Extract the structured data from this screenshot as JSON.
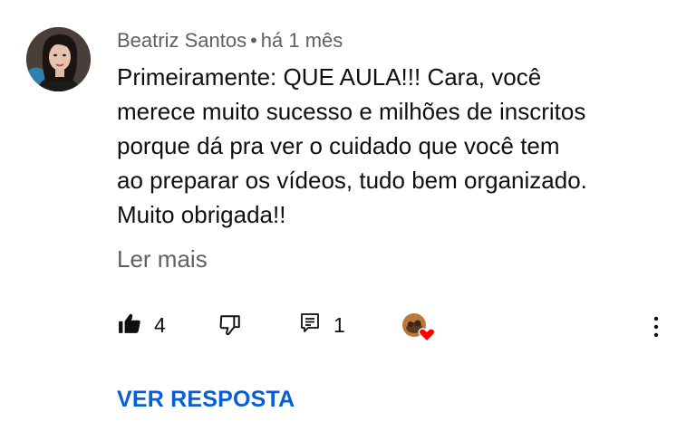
{
  "comment": {
    "author": "Beatriz Santos",
    "separator": "•",
    "time": "há 1 mês",
    "text_lines": [
      "Primeiramente: QUE AULA!!! Cara, você",
      "merece muito sucesso e milhões de inscritos",
      "porque dá pra ver o cuidado que você tem",
      "ao preparar os vídeos, tudo bem organizado.",
      "Muito obrigada!!"
    ],
    "read_more_label": "Ler mais",
    "like_count": "4",
    "reply_count": "1",
    "view_replies_label": "VER RESPOSTA"
  },
  "icons": {
    "like": "thumbs-up-filled-icon",
    "dislike": "thumbs-down-icon",
    "reply": "reply-comment-icon",
    "creator_heart": "creator-heart-icon",
    "more": "more-vertical-icon"
  },
  "colors": {
    "text": "#0f0f0f",
    "secondary_text": "#606060",
    "link": "#065fd4",
    "heart": "#ff0000"
  }
}
